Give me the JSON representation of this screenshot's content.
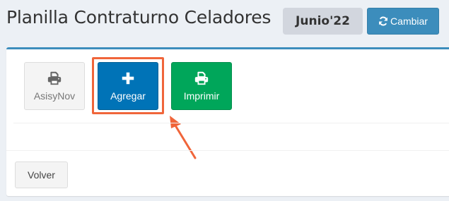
{
  "header": {
    "title": "Planilla Contraturno Celadores",
    "period_badge": "Junio'22",
    "change_button_label": "Cambiar",
    "change_button_icon": "refresh-icon"
  },
  "actions": [
    {
      "id": "asisynov",
      "label": "AsisyNov",
      "icon": "printer-icon",
      "color": "#f4f4f4"
    },
    {
      "id": "agregar",
      "label": "Agregar",
      "icon": "plus-icon",
      "color": "#0073b7"
    },
    {
      "id": "imprimir",
      "label": "Imprimir",
      "icon": "printer-icon",
      "color": "#00a65a"
    }
  ],
  "footer": {
    "back_button_label": "Volver"
  },
  "colors": {
    "accent": "#3c8dbc",
    "annotation": "#f0653a"
  }
}
